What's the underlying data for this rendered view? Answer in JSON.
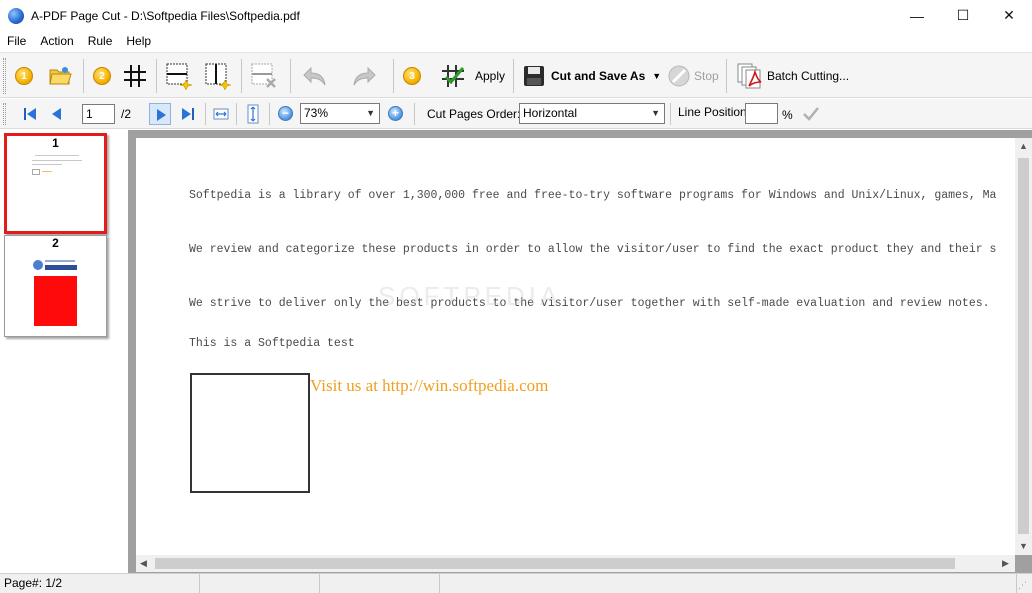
{
  "window": {
    "title": "A-PDF Page Cut - D:\\Softpedia Files\\Softpedia.pdf",
    "minimize_glyph": "—",
    "maximize_glyph": "☐",
    "close_glyph": "✕"
  },
  "menu": [
    "File",
    "Action",
    "Rule",
    "Help"
  ],
  "toolbar1": {
    "step1": "1",
    "step2": "2",
    "step3": "3",
    "apply_label": "Apply",
    "cut_save_label": "Cut and Save As",
    "stop_label": "Stop",
    "batch_label": "Batch Cutting..."
  },
  "toolbar2": {
    "page_value": "1",
    "page_total": "/2",
    "zoom_value": "73%",
    "cut_order_label": "Cut Pages Order:",
    "cut_order_value": "Horizontal",
    "line_position_label": "Line Position:",
    "line_position_value": "",
    "percent_sign": "%"
  },
  "thumbnails": [
    {
      "number": "1",
      "selected": true
    },
    {
      "number": "2",
      "selected": false
    }
  ],
  "document": {
    "lines": [
      "Softpedia is a library of over 1,300,000 free and free-to-try software programs for Windows and Unix/Linux, games, Ma",
      "We review and categorize these products in order to allow the visitor/user to find the exact product they and their s",
      "We strive to deliver only the best products to the visitor/user together with self-made evaluation and review notes.",
      "This is a Softpedia test"
    ],
    "link_text": "Visit us at http://win.softpedia.com",
    "watermark": "SOFTPEDIA"
  },
  "status": {
    "page_info": "Page#: 1/2"
  },
  "colors": {
    "selection": "#e21b1b",
    "link": "#f0a020",
    "doc_bg": "#a0a0a0"
  }
}
